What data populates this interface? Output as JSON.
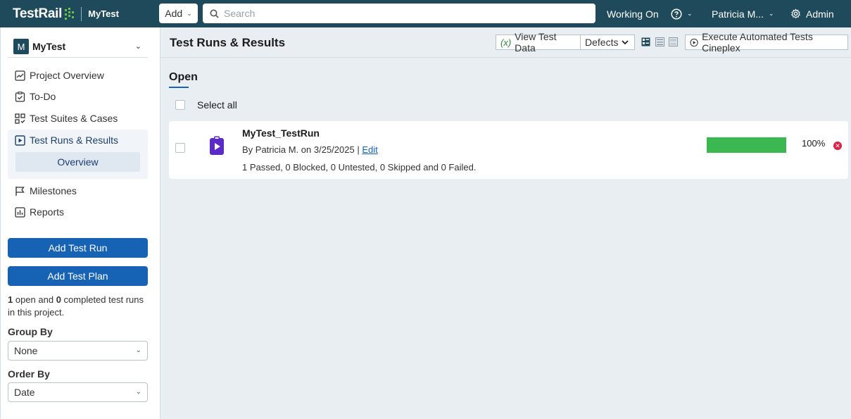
{
  "topbar": {
    "logo_text": "TestRail",
    "project": "MyTest",
    "add_label": "Add",
    "search_placeholder": "Search",
    "working_on": "Working On",
    "user": "Patricia M...",
    "admin": "Admin"
  },
  "sidebar": {
    "project_initial": "M",
    "project_name": "MyTest",
    "nav": [
      {
        "label": "Project Overview",
        "icon": "chart-icon"
      },
      {
        "label": "To-Do",
        "icon": "todo-check-icon"
      },
      {
        "label": "Test Suites & Cases",
        "icon": "suites-grid-icon"
      },
      {
        "label": "Test Runs & Results",
        "icon": "play-box-icon"
      },
      {
        "label": "Milestones",
        "icon": "flag-icon"
      },
      {
        "label": "Reports",
        "icon": "report-icon"
      }
    ],
    "sub_item": "Overview",
    "add_run_button": "Add Test Run",
    "add_plan_button": "Add Test Plan",
    "note": {
      "open_count": "1",
      "middle": " open and ",
      "completed_count": "0",
      "suffix": " completed test runs in this project."
    },
    "group_by_label": "Group By",
    "group_by_value": "None",
    "order_by_label": "Order By",
    "order_by_value": "Date"
  },
  "main": {
    "title": "Test Runs & Results",
    "view_test_data": "View Test Data",
    "defects": "Defects",
    "execute": "Execute Automated Tests Cineplex",
    "section": "Open",
    "select_all": "Select all",
    "runs": [
      {
        "name": "MyTest_TestRun",
        "meta": "By Patricia M. on 3/25/2025 | ",
        "edit": "Edit",
        "stats": "1 Passed, 0 Blocked, 0 Untested, 0 Skipped and 0 Failed.",
        "progress": 100,
        "progress_label": "100%"
      }
    ]
  },
  "colors": {
    "topbar": "#1e4a5c",
    "primary_button": "#1663b5",
    "progress_passed": "#3cb853",
    "run_icon": "#5b2bc8",
    "close": "#d9224a"
  }
}
